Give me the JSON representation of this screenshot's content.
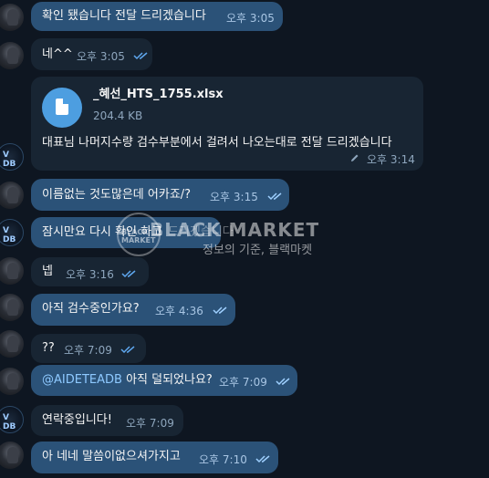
{
  "messages": [
    {
      "text": "확인 됐습니다 전달 드리겠습니다",
      "time": "오후 3:05"
    },
    {
      "text": "네^^",
      "time": "오후 3:05"
    },
    {
      "file_name": "_혜선_HTS_1755.xlsx",
      "file_size": "204.4 KB",
      "text": "대표님 나머지수량 검수부분에서 걸려서 나오는대로 전달 드리겠습니다",
      "time": "오후 3:14"
    },
    {
      "text": "이름없는 것도많은데 어카죠/?",
      "time": "오후 3:15"
    },
    {
      "text": "잠시만요 다시 확인 하고 ",
      "text_tail": "드리겠습니다",
      "time": ""
    },
    {
      "text": "넵",
      "time": "오후 3:16"
    },
    {
      "text": "아직 검수중인가요?",
      "time": "오후 4:36"
    },
    {
      "text": "??",
      "time": "오후 7:09"
    },
    {
      "mention": "@AIDETEADB",
      "text": " 아직 덜되었나요?",
      "time": "오후 7:09"
    },
    {
      "text": "연락중입니다!",
      "time": "오후 7:09"
    },
    {
      "text": "아 네네 말씀이없으셔가지고",
      "time": "오후 7:10"
    }
  ],
  "watermark": {
    "title": "BLACK MARKET",
    "subtitle": "정보의 기준, 블랙마켓",
    "badge": "BLACK MARKET"
  },
  "avatars": {
    "logo_text": "V DB"
  },
  "colors": {
    "background": "#0e1621",
    "incoming": "#182533",
    "outgoing": "#2b5278",
    "accent": "#4d9ee0"
  }
}
